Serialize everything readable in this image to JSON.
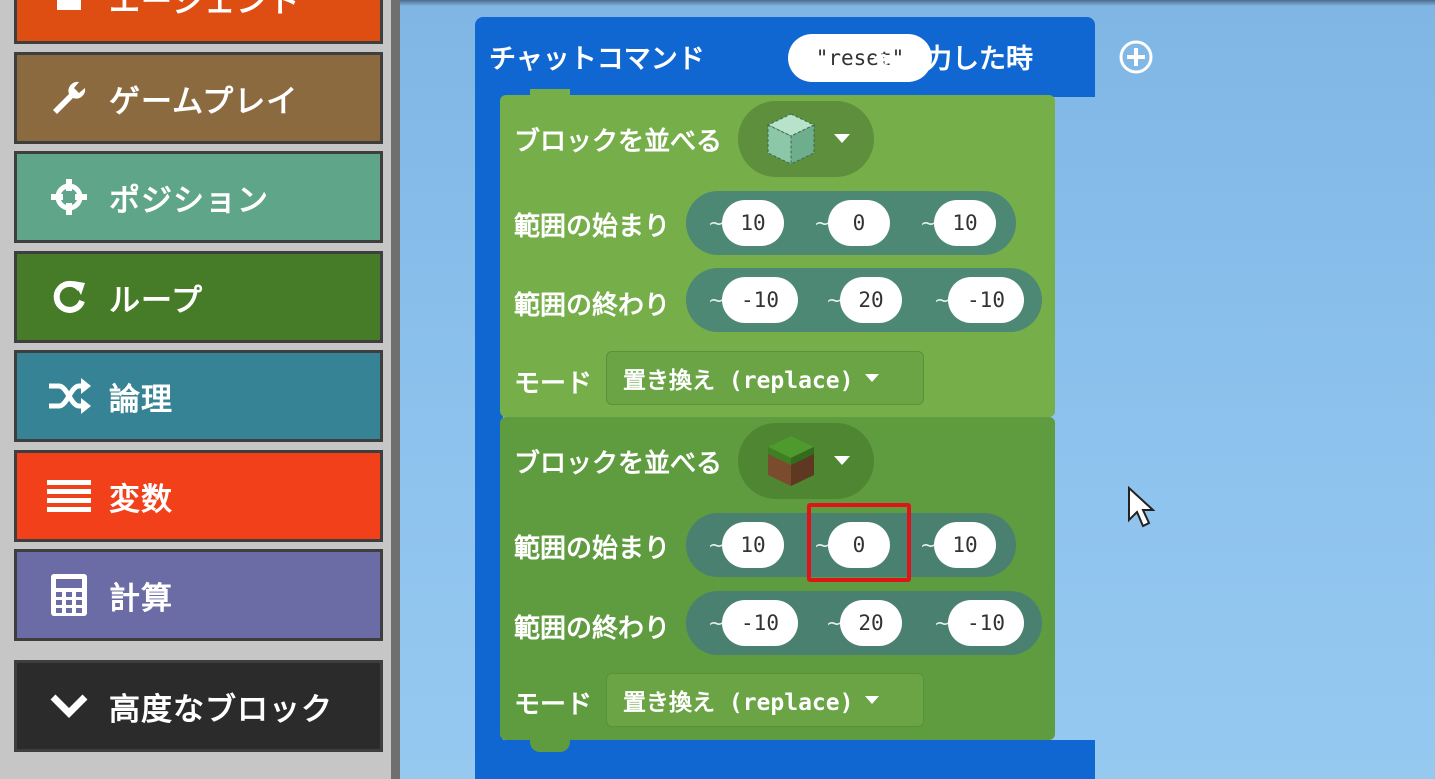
{
  "toolbox": {
    "categories": [
      {
        "label": "エージェント",
        "color": "#de4d11",
        "icon": "agent-icon"
      },
      {
        "label": "ゲームプレイ",
        "color": "#8c6a3f",
        "icon": "wrench-icon"
      },
      {
        "label": "ポジション",
        "color": "#5ea58a",
        "icon": "crosshair-icon"
      },
      {
        "label": "ループ",
        "color": "#467b27",
        "icon": "loop-icon"
      },
      {
        "label": "論理",
        "color": "#368395",
        "icon": "shuffle-icon"
      },
      {
        "label": "変数",
        "color": "#f2401b",
        "icon": "list-icon"
      },
      {
        "label": "計算",
        "color": "#6b6ba6",
        "icon": "calculator-icon"
      },
      {
        "label": "高度なブロック",
        "color": "#2b2b2b",
        "icon": "chevron-down-icon"
      }
    ]
  },
  "workspace": {
    "event": {
      "label": "チャットコマンド",
      "command": "\"reset\"",
      "suffix": "を入力した時",
      "icon": "plus-icon"
    },
    "fill_blocks": [
      {
        "label": "ブロックを並べる",
        "block": "glass-block-icon",
        "from_label": "範囲の始まり",
        "from": {
          "x": "10",
          "y": "0",
          "z": "10"
        },
        "to_label": "範囲の終わり",
        "to": {
          "x": "-10",
          "y": "20",
          "z": "-10"
        },
        "mode_label": "モード",
        "mode": "置き換え (replace)"
      },
      {
        "label": "ブロックを並べる",
        "block": "grass-block-icon",
        "from_label": "範囲の始まり",
        "from": {
          "x": "10",
          "y": "0",
          "z": "10"
        },
        "to_label": "範囲の終わり",
        "to": {
          "x": "-10",
          "y": "20",
          "z": "-10"
        },
        "mode_label": "モード",
        "mode": "置き換え (replace)"
      }
    ],
    "tilde": "~",
    "highlight_color": "#e0131a"
  }
}
